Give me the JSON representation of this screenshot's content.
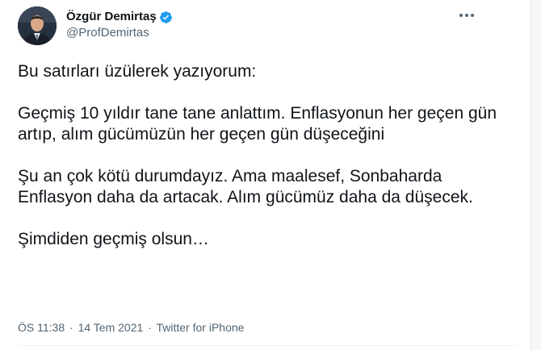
{
  "author": {
    "display_name": "Özgür Demirtaş",
    "handle": "@ProfDemirtas",
    "verified": true,
    "verified_icon": "verified-badge-icon",
    "avatar_icon": "profile-photo"
  },
  "tweet": {
    "paragraphs": [
      "Bu satırları üzülerek yazıyorum:",
      "Geçmiş 10 yıldır tane tane anlattım. Enflasyonun her geçen gün artıp, alım gücümüzün her geçen gün düşeceğini",
      "Şu an çok kötü durumdayız. Ama maalesef, Sonbaharda Enflasyon daha da artacak. Alım gücümüz daha da düşecek.",
      "Şimdiden geçmiş olsun…"
    ]
  },
  "meta": {
    "time": "ÖS 11:38",
    "separator": "·",
    "date": "14 Tem 2021",
    "source": "Twitter for iPhone"
  },
  "actions": {
    "more_icon": "more-options-icon"
  },
  "colors": {
    "text": "#0f1419",
    "secondary": "#536471",
    "verified": "#1d9bf0"
  }
}
